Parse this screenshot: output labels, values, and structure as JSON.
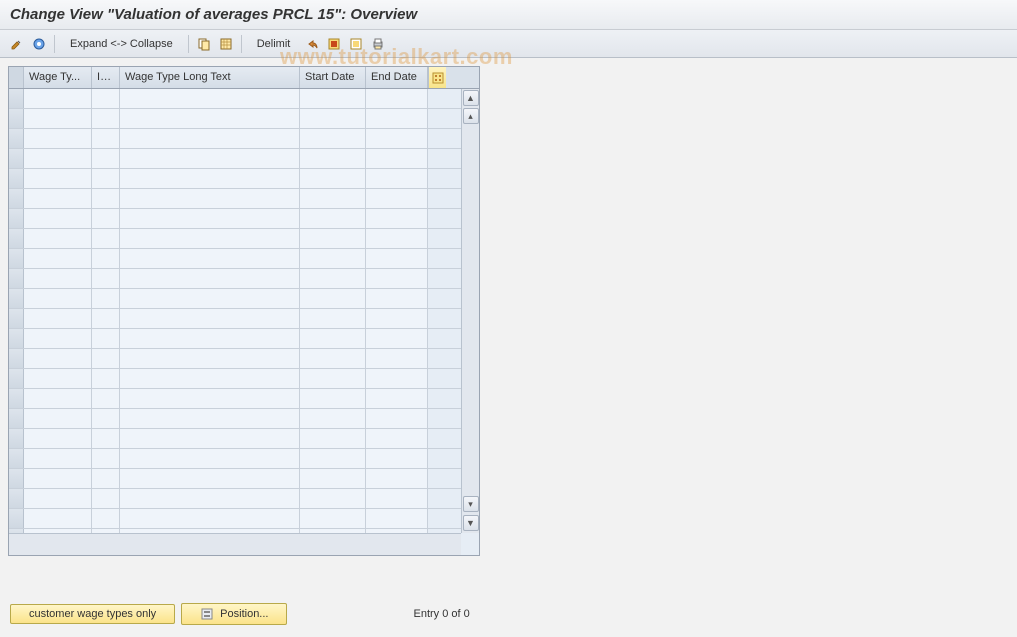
{
  "title": "Change View \"Valuation of averages PRCL 15\": Overview",
  "toolbar": {
    "expand_collapse_label": "Expand <-> Collapse",
    "delimit_label": "Delimit"
  },
  "table": {
    "columns": {
      "wage_type": "Wage Ty...",
      "inf": "Inf...",
      "long_text": "Wage Type Long Text",
      "start_date": "Start Date",
      "end_date": "End Date"
    },
    "rows": [
      {},
      {},
      {},
      {},
      {},
      {},
      {},
      {},
      {},
      {},
      {},
      {},
      {},
      {},
      {},
      {},
      {},
      {},
      {},
      {},
      {},
      {},
      {}
    ]
  },
  "footer": {
    "customer_btn": "customer wage types only",
    "position_btn": "Position...",
    "entry_label": "Entry 0 of 0"
  },
  "watermark": "www.tutorialkart.com"
}
